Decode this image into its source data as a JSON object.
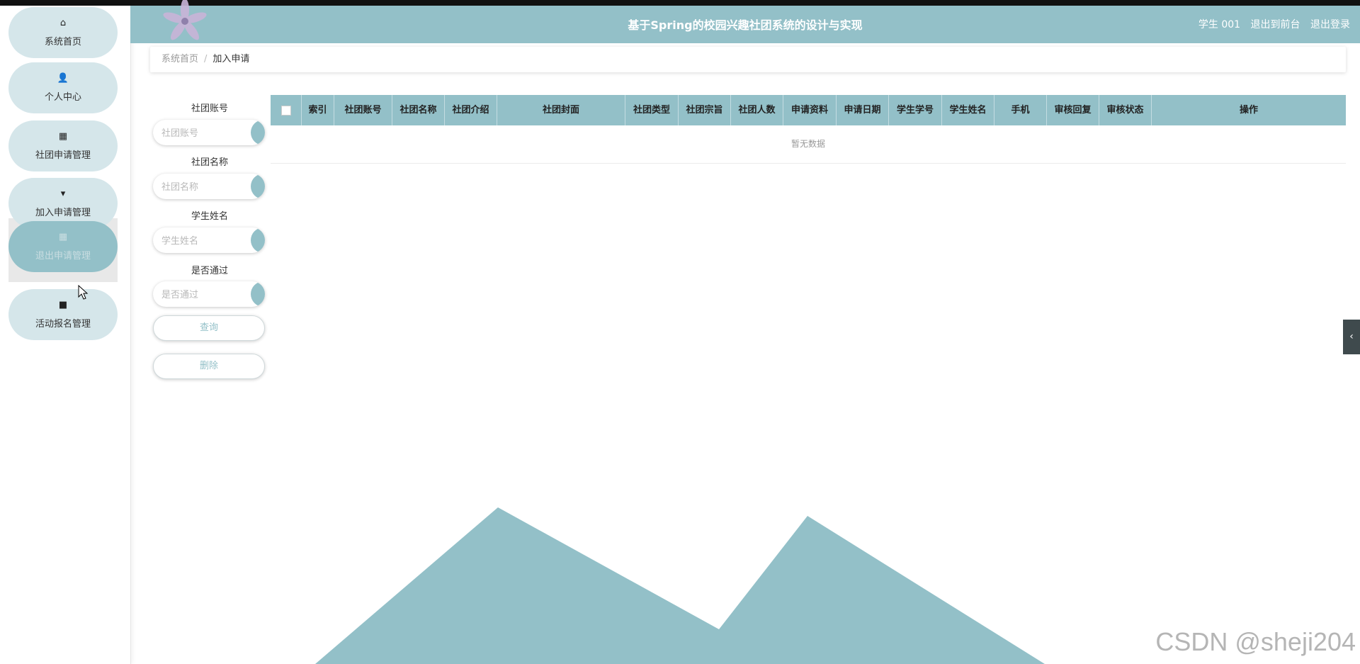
{
  "header": {
    "title": "基于Spring的校园兴趣社团系统的设计与实现",
    "user": "学生 001",
    "front_link": "退出到前台",
    "logout_link": "退出登录"
  },
  "sidebar": {
    "items": [
      {
        "label": "系统首页",
        "icon": "home-icon",
        "glyph": "⌂"
      },
      {
        "label": "个人中心",
        "icon": "user-icon",
        "glyph": "👤"
      },
      {
        "label": "社团申请管理",
        "icon": "grid-icon",
        "glyph": "▦"
      },
      {
        "label": "加入申请管理",
        "icon": "bookmark-icon",
        "glyph": "▾"
      },
      {
        "label": "退出申请管理",
        "icon": "grid-icon",
        "glyph": "▦"
      },
      {
        "label": "活动报名管理",
        "icon": "book-icon",
        "glyph": "■"
      }
    ]
  },
  "breadcrumb": {
    "home": "系统首页",
    "separator": "/",
    "current": "加入申请"
  },
  "search": {
    "club_account": {
      "label": "社团账号",
      "placeholder": "社团账号"
    },
    "club_name": {
      "label": "社团名称",
      "placeholder": "社团名称"
    },
    "student_name": {
      "label": "学生姓名",
      "placeholder": "学生姓名"
    },
    "passed": {
      "label": "是否通过",
      "placeholder": "是否通过"
    },
    "query_button": "查询",
    "delete_button": "删除"
  },
  "table": {
    "columns": [
      "索引",
      "社团账号",
      "社团名称",
      "社团介绍",
      "社团封面",
      "社团类型",
      "社团宗旨",
      "社团人数",
      "申请资料",
      "申请日期",
      "学生学号",
      "学生姓名",
      "手机",
      "审核回复",
      "审核状态",
      "操作"
    ],
    "empty_text": "暂无数据"
  },
  "colors": {
    "accent": "#93c0c8",
    "nav_bg": "#d5e6ea"
  },
  "collapse_icon": "‹",
  "watermark": "CSDN @sheji204"
}
